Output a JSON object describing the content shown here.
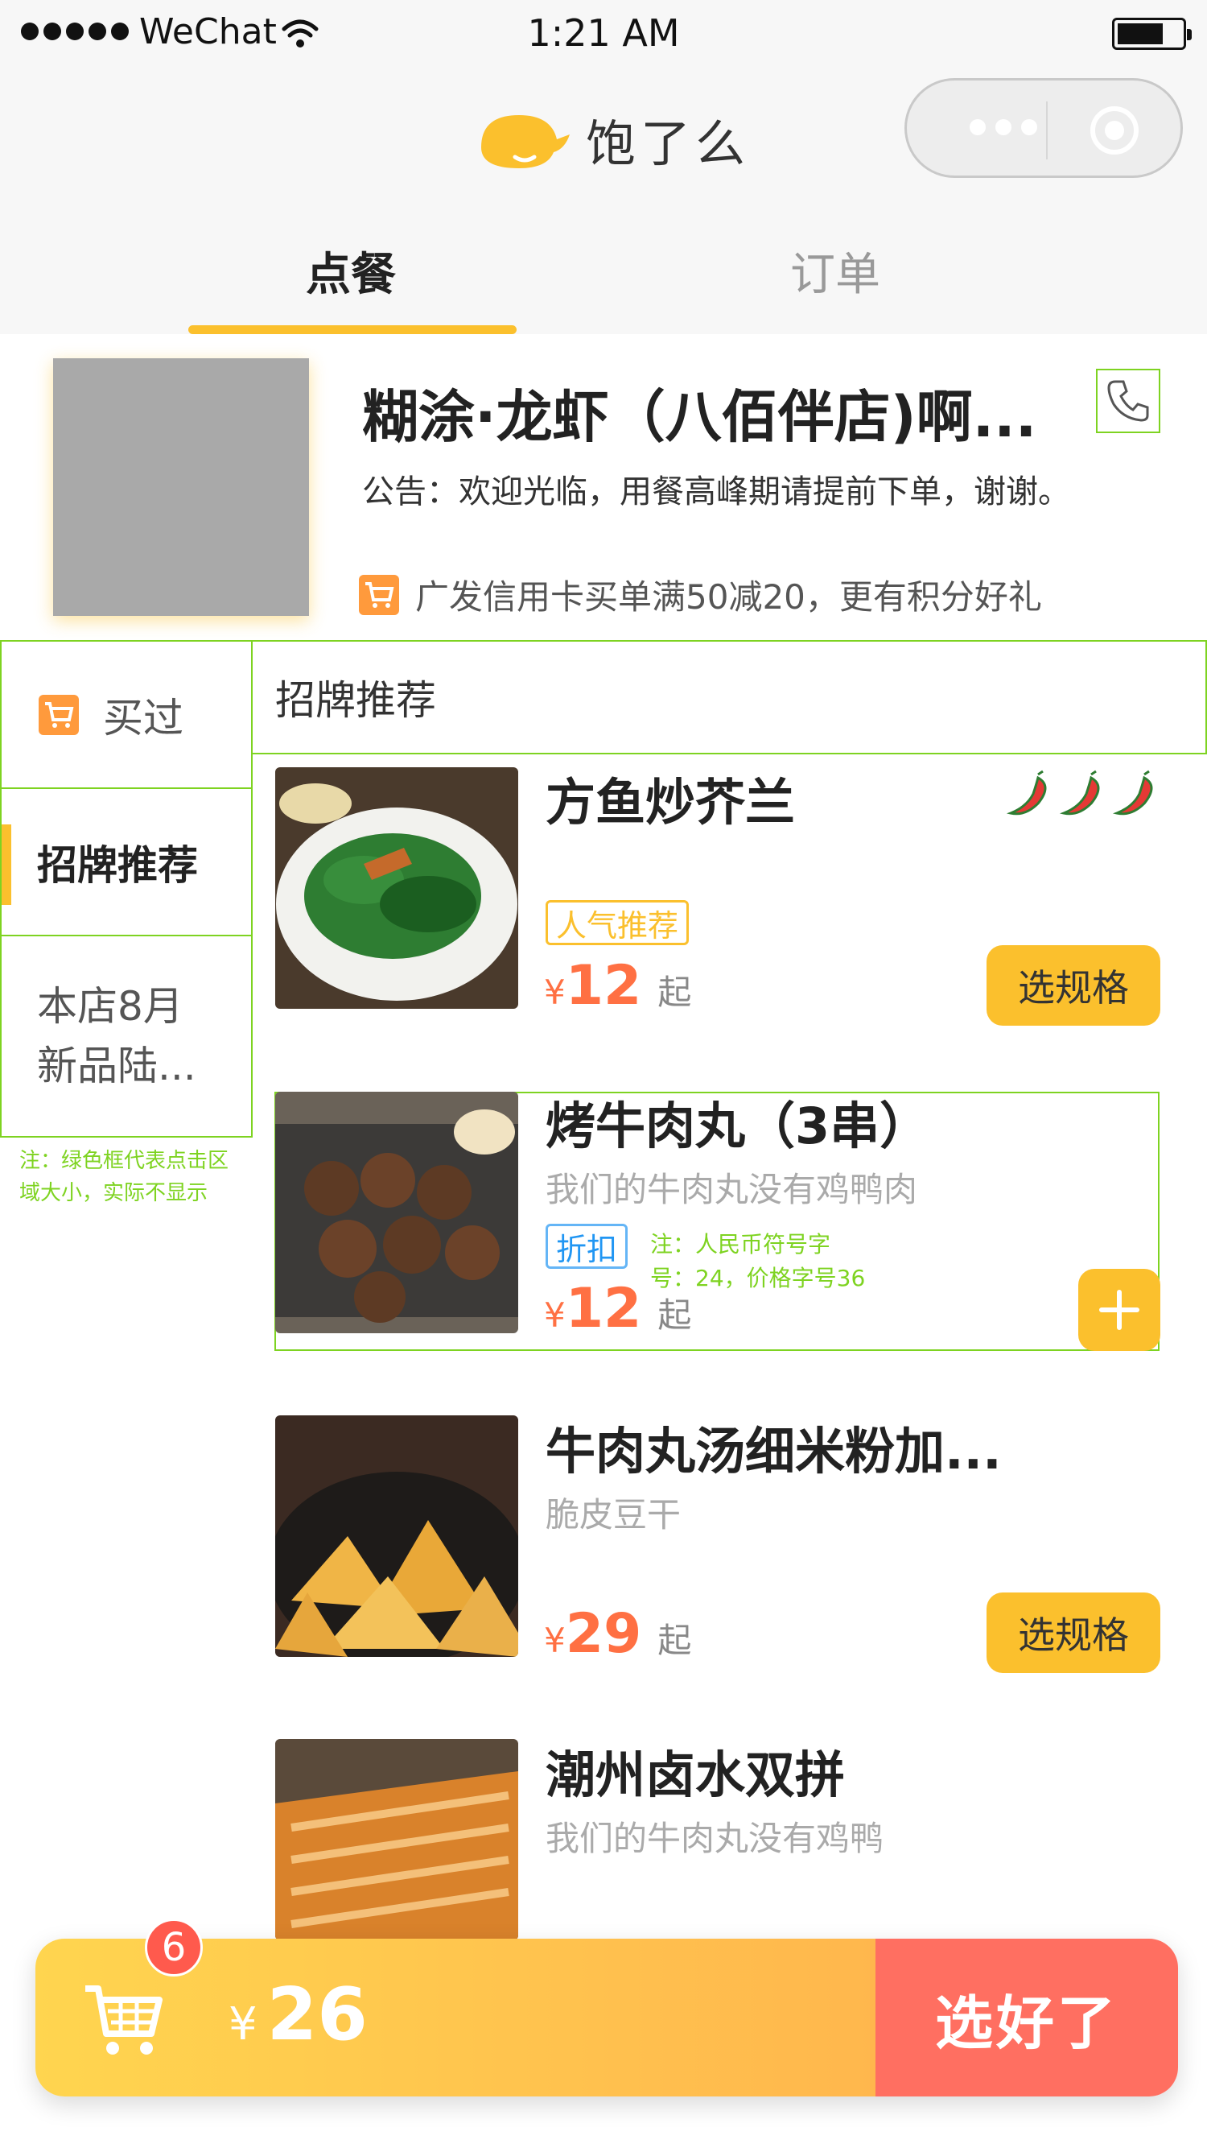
{
  "status_bar": {
    "carrier": "WeChat",
    "time": "1:21 AM"
  },
  "header": {
    "app_name": "饱了么"
  },
  "tabs": [
    {
      "label": "点餐",
      "active": true
    },
    {
      "label": "订单",
      "active": false
    }
  ],
  "shop": {
    "name": "糊涂·龙虾（八佰伴店)啊...",
    "notice": "公告：欢迎光临，用餐高峰期请提前下单，谢谢。",
    "promo": "广发信用卡买单满50减20，更有积分好礼"
  },
  "sidebar": {
    "items": [
      {
        "label": "买过",
        "icon": "cart-icon"
      },
      {
        "label": "招牌推荐",
        "active": true
      },
      {
        "label_line1": "本店8月",
        "label_line2": "新品陆..."
      }
    ],
    "note": "注：绿色框代表点击区域大小，实际不显示"
  },
  "section": {
    "title": "招牌推荐"
  },
  "dishes": [
    {
      "name": "方鱼炒芥兰",
      "tag": "人气推荐",
      "currency": "¥",
      "price": "12",
      "price_suffix": "起",
      "action": "选规格",
      "spice_level": 3
    },
    {
      "name": "烤牛肉丸（3串）",
      "desc": "我们的牛肉丸没有鸡鸭肉",
      "tag": "折扣",
      "currency": "¥",
      "price": "12",
      "price_suffix": "起",
      "note_line1": "注：人民币符号字",
      "note_line2": "号：24，价格字号36"
    },
    {
      "name": "牛肉丸汤细米粉加...",
      "desc": "脆皮豆干",
      "currency": "¥",
      "price": "29",
      "price_suffix": "起",
      "action": "选规格"
    },
    {
      "name": "潮州卤水双拼",
      "desc": "我们的牛肉丸没有鸡鸭"
    }
  ],
  "cart": {
    "count": "6",
    "currency": "¥",
    "total": "26",
    "checkout_label": "选好了"
  },
  "colors": {
    "accent": "#fbc02d",
    "price": "#ff7043",
    "checkout": "#ff6f61",
    "hitbox": "#7ed321"
  }
}
